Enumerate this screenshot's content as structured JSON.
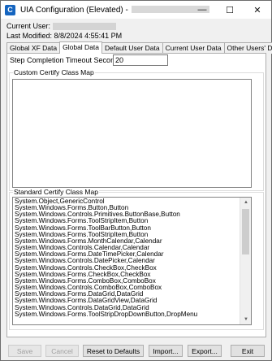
{
  "window": {
    "title": "UIA Configuration (Elevated) -",
    "icon_letter": "C",
    "icon_color": "#1565c0",
    "controls": {
      "minimize": "—",
      "maximize": "☐",
      "close": "✕"
    }
  },
  "info": {
    "current_user_label": "Current User:",
    "last_modified_label": "Last Modified:",
    "last_modified_value": "8/8/2024 4:55:41 PM"
  },
  "tabs": [
    {
      "label": "Global XF Data",
      "active": false
    },
    {
      "label": "Global Data",
      "active": true
    },
    {
      "label": "Default User Data",
      "active": false
    },
    {
      "label": "Current User Data",
      "active": false
    },
    {
      "label": "Other Users' Data",
      "active": false
    }
  ],
  "global_data": {
    "timeout_label": "Step Completion Timeout Seconds:",
    "timeout_value": "20",
    "custom_map_label": "Custom Certify Class Map",
    "standard_map_label": "Standard Certify Class Map",
    "standard_map_lines": [
      "System.Object,GenericControl",
      "System.Windows.Forms.Button,Button",
      "System.Windows.Controls.Primitives.ButtonBase,Button",
      "System.Windows.Forms.ToolStripItem,Button",
      "System.Windows.Forms.ToolBarButton,Button",
      "System.Windows.Forms.ToolStripItem,Button",
      "System.Windows.Forms.MonthCalendar,Calendar",
      "System.Windows.Controls.Calendar,Calendar",
      "System.Windows.Forms.DateTimePicker,Calendar",
      "System.Windows.Controls.DatePicker,Calendar",
      "System.Windows.Controls.CheckBox,CheckBox",
      "System.Windows.Forms.CheckBox,CheckBox",
      "System.Windows.Forms.ComboBox,ComboBox",
      "System.Windows.Controls.ComboBox,ComboBox",
      "System.Windows.Forms.DataGrid,DataGrid",
      "System.Windows.Forms.DataGridView,DataGrid",
      "System.Windows.Controls.DataGrid,DataGrid",
      "System.Windows.Forms.ToolStripDropDownButton,DropMenu"
    ]
  },
  "buttons": {
    "save": "Save",
    "cancel": "Cancel",
    "reset": "Reset to Defaults",
    "import": "Import...",
    "export": "Export...",
    "exit": "Exit"
  }
}
